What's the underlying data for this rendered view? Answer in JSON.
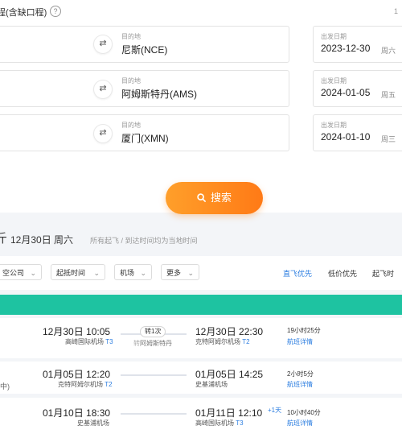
{
  "header": {
    "title": "程(含缺口程)",
    "help_icon": "?",
    "right_text": "1"
  },
  "routes": [
    {
      "dest_label": "目的地",
      "dest": "尼斯(NCE)",
      "date_label": "出发日期",
      "date": "2023-12-30",
      "weekday": "周六"
    },
    {
      "dest_label": "目的地",
      "dest": "阿姆斯特丹(AMS)",
      "date_label": "出发日期",
      "date": "2024-01-05",
      "weekday": "周五"
    },
    {
      "dest_label": "目的地",
      "dest": "厦门(XMN)",
      "date_label": "出发日期",
      "date": "2024-01-10",
      "weekday": "周三"
    }
  ],
  "swap_icon": "⇄",
  "search": {
    "label": "搜索"
  },
  "results": {
    "prefix": "斤",
    "date_heading": "12月30日 周六",
    "note": "所有起飞 / 到达时间均为当地时间"
  },
  "filters": [
    "空公司",
    "起抵时间",
    "机场",
    "更多"
  ],
  "sorts": [
    "直飞优先",
    "低价优先",
    "起飞时"
  ],
  "flights": [
    {
      "dep_time": "12月30日 10:05",
      "dep_airport": "高崎国际机场",
      "dep_term": "T3",
      "stop": "转1次",
      "stop_prefix": "转",
      "stop_city": "阿姆斯特丹",
      "arr_time": "12月30日 22:30",
      "arr_airport": "克特阿姆尔机场",
      "arr_term": "T2",
      "duration": "19小时25分",
      "detail": "航班详情",
      "left_tag": "",
      "plus_day": ""
    },
    {
      "dep_time": "01月05日 12:20",
      "dep_airport": "克特阿姆尔机场",
      "dep_term": "T2",
      "stop": "",
      "stop_prefix": "",
      "stop_city": "",
      "arr_time": "01月05日 14:25",
      "arr_airport": "史基浦机场",
      "arr_term": "",
      "duration": "2小时5分",
      "detail": "航班详情",
      "left_tag": "(中)",
      "plus_day": ""
    },
    {
      "dep_time": "01月10日 18:30",
      "dep_airport": "史基浦机场",
      "dep_term": "",
      "stop": "",
      "stop_prefix": "",
      "stop_city": "",
      "arr_time": "01月11日 12:10",
      "arr_airport": "高崎国际机场",
      "arr_term": "T3",
      "duration": "10小时40分",
      "detail": "航班详情",
      "left_tag": "",
      "plus_day": "+1天"
    }
  ],
  "colors": {
    "accent": "#ff8a1f",
    "link": "#2b7de0",
    "teal": "#1ec3a1"
  }
}
